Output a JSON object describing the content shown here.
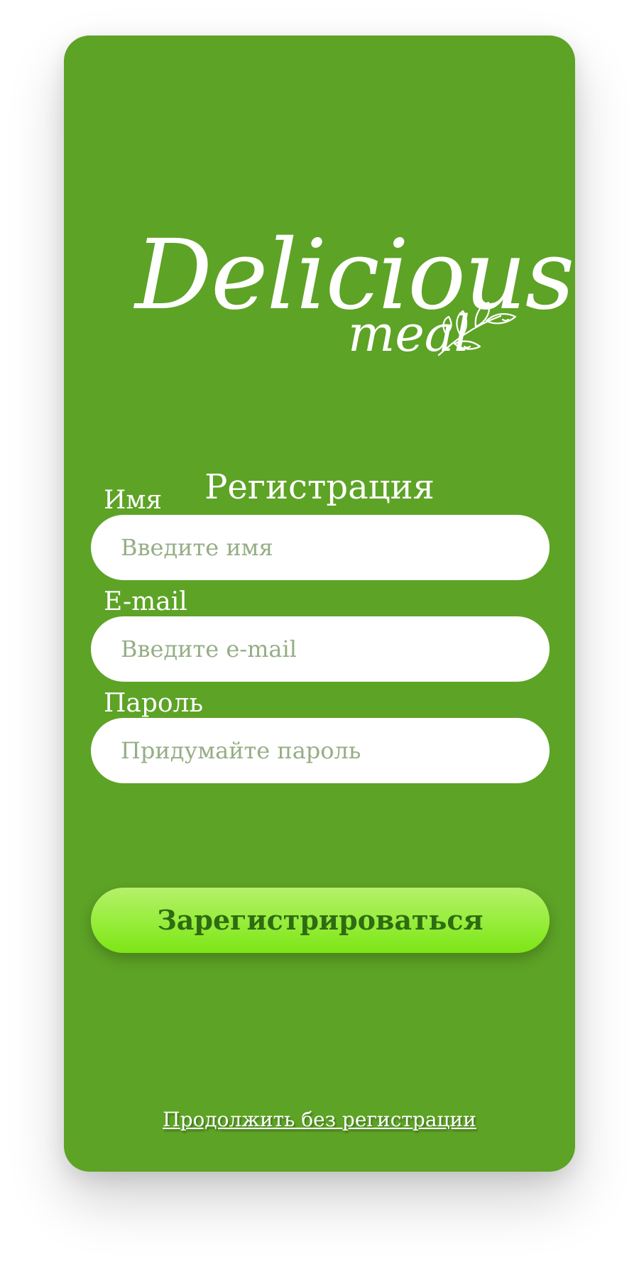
{
  "brand": {
    "word": "Delicious",
    "sub": "meal"
  },
  "form": {
    "title": "Регистрация",
    "fields": [
      {
        "label": "Имя",
        "placeholder": "Введите имя",
        "value": ""
      },
      {
        "label": "E-mail",
        "placeholder": "Введите e-mail",
        "value": ""
      },
      {
        "label": "Пароль",
        "placeholder": "Придумайте пароль",
        "value": ""
      }
    ],
    "submit_label": "Зарегистрироваться",
    "skip_label": "Продолжить без регистрации"
  },
  "colors": {
    "card": "#5da326",
    "button_top": "#b5f06a",
    "button_bottom": "#7de516",
    "button_text": "#2f6b12",
    "placeholder": "#95ae85"
  }
}
